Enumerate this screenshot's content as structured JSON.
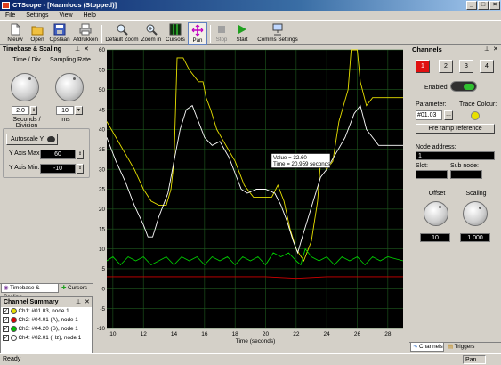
{
  "window": {
    "title": "CTScope - [Naamloos (Stopped)]"
  },
  "menu": [
    "File",
    "Settings",
    "View",
    "Help"
  ],
  "toolbar": {
    "new": "Nieuw",
    "open": "Open",
    "save": "Opslaan",
    "print": "Afdrukken",
    "default_zoom": "Default Zoom",
    "zoom_in": "Zoom in",
    "cursors": "Cursors",
    "pan": "Pan",
    "stop": "Stop",
    "start": "Start",
    "comms": "Comms Settings"
  },
  "timebase": {
    "header": "Timebase & Scaling",
    "time_div_label": "Time / Div",
    "sampling_label": "Sampling Rate",
    "time_div_value": "2.0",
    "sampling_value": "10",
    "seconds_label": "Seconds / Division",
    "ms_label": "ms",
    "autoscale_label": "Autoscale Y",
    "ymax_label": "Y Axis Max:",
    "ymax_value": "60",
    "ymin_label": "Y Axis Min:",
    "ymin_value": "-10",
    "tab_scaling": "Timebase & Scaling",
    "tab_cursors": "Cursors"
  },
  "summary": {
    "header": "Channel Summary",
    "items": [
      {
        "label": "Ch1: #01.03, node 1",
        "color": "#e8e000"
      },
      {
        "label": "Ch2: #04.01 (A), node 1",
        "color": "#e00000"
      },
      {
        "label": "Ch3: #04.20 (S), node 1",
        "color": "#00c000"
      },
      {
        "label": "Ch4: #02.01 (Hz), node 1",
        "color": "#ffffff"
      }
    ]
  },
  "channels": {
    "header": "Channels",
    "buttons": [
      "1",
      "2",
      "3",
      "4"
    ],
    "enabled_label": "Enabled",
    "parameter_label": "Parameter:",
    "parameter_value": "#01.03",
    "browse_label": "...",
    "trace_colour_label": "Trace Colour:",
    "trace_colour": "#e8e000",
    "description": "Pre ramp reference",
    "node_address_label": "Node address:",
    "node_address_value": "1",
    "slot_label": "Slot:",
    "subnode_label": "Sub node:",
    "offset_label": "Offset",
    "scaling_label": "Scaling",
    "offset_value": "10",
    "scaling_value": "1.000",
    "tab_channels": "Channels",
    "tab_triggers": "Triggers"
  },
  "status": {
    "left": "Ready",
    "right": "Pan"
  },
  "chart_data": {
    "type": "line",
    "xlabel": "Time (seconds)",
    "ylabel": "",
    "xlim": [
      9.6,
      29
    ],
    "ylim": [
      -10,
      60
    ],
    "xticks": [
      10,
      12,
      14,
      16,
      18,
      20,
      22,
      24,
      26,
      28
    ],
    "yticks": [
      60,
      55,
      50,
      45,
      40,
      35,
      30,
      25,
      20,
      15,
      10,
      5,
      0,
      -5,
      -10
    ],
    "grid": true,
    "tooltip": {
      "line1": "Value = 32.60",
      "line2": "Time = 20.959 seconds",
      "x": 20.959,
      "y": 32.6
    },
    "series": [
      {
        "color": "#e8e000",
        "points": [
          [
            9.6,
            42
          ],
          [
            10.2,
            38
          ],
          [
            10.8,
            34
          ],
          [
            11.4,
            30
          ],
          [
            12,
            25
          ],
          [
            12.5,
            22
          ],
          [
            13,
            21
          ],
          [
            13.5,
            21
          ],
          [
            13.8,
            25
          ],
          [
            14,
            32
          ],
          [
            14.2,
            58
          ],
          [
            14.6,
            58
          ],
          [
            15,
            55
          ],
          [
            15.6,
            52
          ],
          [
            15.9,
            52
          ],
          [
            16.1,
            48
          ],
          [
            16.4,
            45
          ],
          [
            16.8,
            40
          ],
          [
            17.4,
            36
          ],
          [
            18,
            32
          ],
          [
            18.6,
            26
          ],
          [
            19.2,
            23
          ],
          [
            19.8,
            23
          ],
          [
            20.4,
            23
          ],
          [
            20.8,
            26
          ],
          [
            21.2,
            22
          ],
          [
            21.6,
            15
          ],
          [
            22,
            10
          ],
          [
            22.5,
            7
          ],
          [
            23,
            12
          ],
          [
            23.4,
            22
          ],
          [
            23.6,
            32
          ],
          [
            24,
            30
          ],
          [
            24.4,
            32
          ],
          [
            24.8,
            42
          ],
          [
            25.4,
            50
          ],
          [
            25.6,
            60
          ],
          [
            26,
            60
          ],
          [
            26.2,
            52
          ],
          [
            26.6,
            46
          ],
          [
            27,
            48
          ],
          [
            27.4,
            48
          ],
          [
            28,
            48
          ],
          [
            29,
            48
          ]
        ]
      },
      {
        "color": "#ffffff",
        "points": [
          [
            9.6,
            38
          ],
          [
            10.2,
            32
          ],
          [
            10.8,
            27
          ],
          [
            11.4,
            21
          ],
          [
            12,
            16
          ],
          [
            12.3,
            13
          ],
          [
            12.6,
            13
          ],
          [
            13,
            18
          ],
          [
            13.6,
            24
          ],
          [
            14,
            32
          ],
          [
            14.4,
            40
          ],
          [
            14.8,
            45
          ],
          [
            15.2,
            46
          ],
          [
            15.6,
            42
          ],
          [
            16,
            38
          ],
          [
            16.5,
            36
          ],
          [
            17,
            37
          ],
          [
            17.6,
            33
          ],
          [
            18,
            29
          ],
          [
            18.4,
            25
          ],
          [
            18.8,
            24
          ],
          [
            19.4,
            25
          ],
          [
            20,
            25
          ],
          [
            20.6,
            24
          ],
          [
            21,
            21
          ],
          [
            21.4,
            17
          ],
          [
            21.8,
            12
          ],
          [
            22.1,
            9
          ],
          [
            22.4,
            13
          ],
          [
            22.8,
            18
          ],
          [
            23.2,
            23
          ],
          [
            23.6,
            28
          ],
          [
            24,
            30
          ],
          [
            24.6,
            34
          ],
          [
            25.2,
            38
          ],
          [
            25.8,
            44
          ],
          [
            26.2,
            46
          ],
          [
            26.6,
            40
          ],
          [
            27,
            38
          ],
          [
            27.4,
            36
          ],
          [
            27.8,
            36
          ],
          [
            28.2,
            36
          ],
          [
            29,
            36
          ]
        ]
      },
      {
        "color": "#00d000",
        "points": [
          [
            9.6,
            7
          ],
          [
            10,
            8
          ],
          [
            10.5,
            6
          ],
          [
            11,
            8
          ],
          [
            11.5,
            7
          ],
          [
            12,
            8
          ],
          [
            12.5,
            6
          ],
          [
            13,
            7
          ],
          [
            13.5,
            8
          ],
          [
            14,
            6
          ],
          [
            14.5,
            8
          ],
          [
            15,
            7
          ],
          [
            15.5,
            8
          ],
          [
            16,
            6
          ],
          [
            16.5,
            8
          ],
          [
            17,
            7
          ],
          [
            17.5,
            8
          ],
          [
            18,
            6
          ],
          [
            18.5,
            8
          ],
          [
            19,
            7
          ],
          [
            19.5,
            8
          ],
          [
            20,
            6
          ],
          [
            20.5,
            9
          ],
          [
            21,
            8
          ],
          [
            21.5,
            9
          ],
          [
            22,
            7
          ],
          [
            22.3,
            6
          ],
          [
            22.6,
            10
          ],
          [
            23,
            8
          ],
          [
            23.5,
            7
          ],
          [
            24,
            8
          ],
          [
            24.5,
            6
          ],
          [
            25,
            8
          ],
          [
            25.5,
            7
          ],
          [
            26,
            8
          ],
          [
            26.5,
            6
          ],
          [
            27,
            8
          ],
          [
            27.5,
            7
          ],
          [
            28,
            8
          ],
          [
            29,
            7
          ]
        ]
      },
      {
        "color": "#d00000",
        "points": [
          [
            9.6,
            3
          ],
          [
            12,
            3
          ],
          [
            16,
            3
          ],
          [
            20,
            3
          ],
          [
            22,
            2.6
          ],
          [
            24,
            3
          ],
          [
            29,
            3
          ]
        ]
      }
    ]
  }
}
